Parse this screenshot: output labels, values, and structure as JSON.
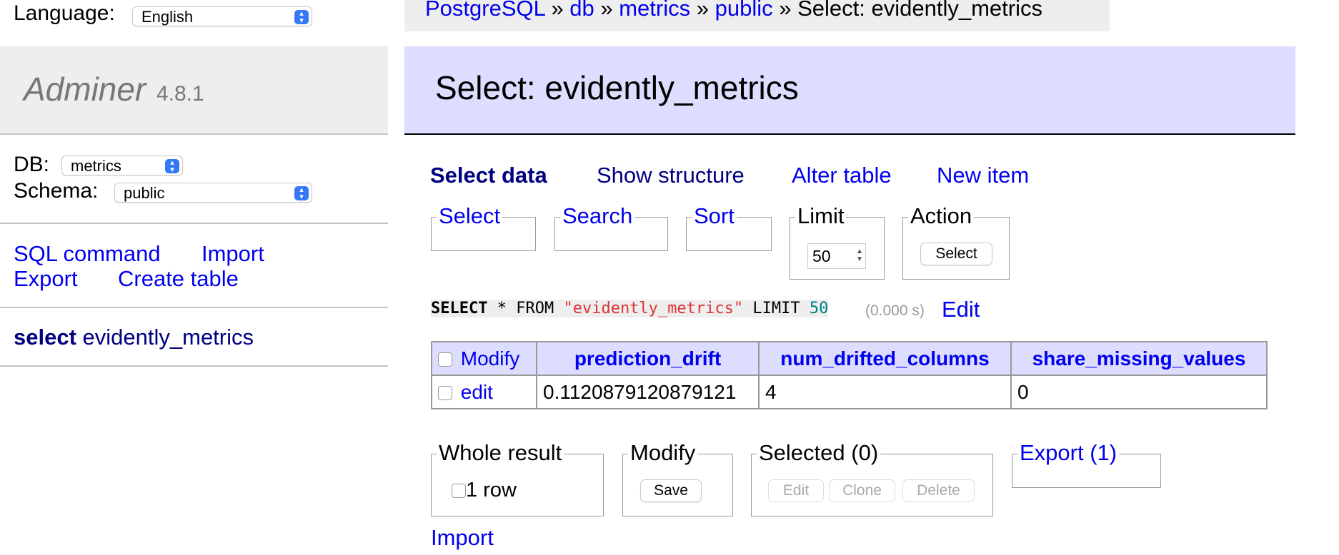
{
  "sidebar": {
    "language_label": "Language:",
    "language_value": "English",
    "app_name": "Adminer",
    "version": "4.8.1",
    "db_label": "DB:",
    "db_value": "metrics",
    "schema_label": "Schema:",
    "schema_value": "public",
    "links": [
      "SQL command",
      "Import",
      "Export",
      "Create table"
    ],
    "table_link_prefix": "select",
    "table_link_name": "evidently_metrics"
  },
  "breadcrumb": {
    "items": [
      "PostgreSQL",
      "db",
      "metrics",
      "public"
    ],
    "separator": "»",
    "current": "Select: evidently_metrics"
  },
  "page_title": "Select: evidently_metrics",
  "tabs": [
    "Select data",
    "Show structure",
    "Alter table",
    "New item"
  ],
  "filters": {
    "select": "Select",
    "search": "Search",
    "sort": "Sort",
    "limit_label": "Limit",
    "limit_value": "50",
    "action_label": "Action",
    "action_button": "Select"
  },
  "query": {
    "kw_select": "SELECT",
    "star": "*",
    "kw_from": "FROM",
    "table": "\"evidently_metrics\"",
    "kw_limit": "LIMIT",
    "limit": "50",
    "time": "(0.000 s)",
    "edit": "Edit"
  },
  "table": {
    "modify_header": "Modify",
    "columns": [
      "prediction_drift",
      "num_drifted_columns",
      "share_missing_values"
    ],
    "rows": [
      {
        "edit": "edit",
        "cells": [
          "0.1120879120879121",
          "4",
          "0"
        ]
      }
    ]
  },
  "bottom": {
    "whole_result_label": "Whole result",
    "row_count": "1 row",
    "modify_label": "Modify",
    "save_button": "Save",
    "selected_label": "Selected (0)",
    "edit_button": "Edit",
    "clone_button": "Clone",
    "delete_button": "Delete",
    "export_label": "Export (1)",
    "import_link": "Import"
  }
}
